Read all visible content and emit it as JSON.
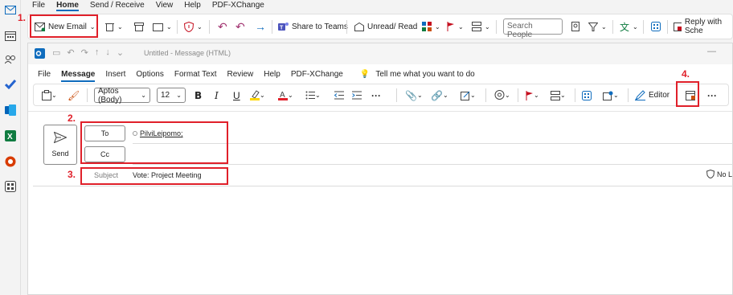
{
  "outer_menu": [
    "File",
    "Home",
    "Send / Receive",
    "View",
    "Help",
    "PDF-XChange"
  ],
  "outer_menu_active": "Home",
  "toolbar": {
    "new_email": "New Email",
    "share_to_teams": "Share to Teams",
    "unread_read": "Unread/ Read",
    "search_people_placeholder": "Search People",
    "reply_with": "Reply with Sche"
  },
  "compose": {
    "window_title": "Untitled - Message (HTML)",
    "menu": [
      "File",
      "Message",
      "Insert",
      "Options",
      "Format Text",
      "Review",
      "Help",
      "PDF-XChange"
    ],
    "menu_active": "Message",
    "tell_me": "Tell me what you want to do",
    "font_name": "Aptos (Body)",
    "font_size": "12",
    "bold": "B",
    "italic": "I",
    "underline": "U",
    "editor": "Editor",
    "send": "Send",
    "to": "To",
    "cc": "Cc",
    "recipient": "PilviLeipomo;",
    "subject_label": "Subject",
    "subject_value": "Vote: Project Meeting",
    "no_label": "No L"
  },
  "annotations": [
    "1.",
    "2.",
    "3.",
    "4."
  ],
  "colors": {
    "accent": "#0f6cbd",
    "annotation_red": "#e0202a"
  }
}
